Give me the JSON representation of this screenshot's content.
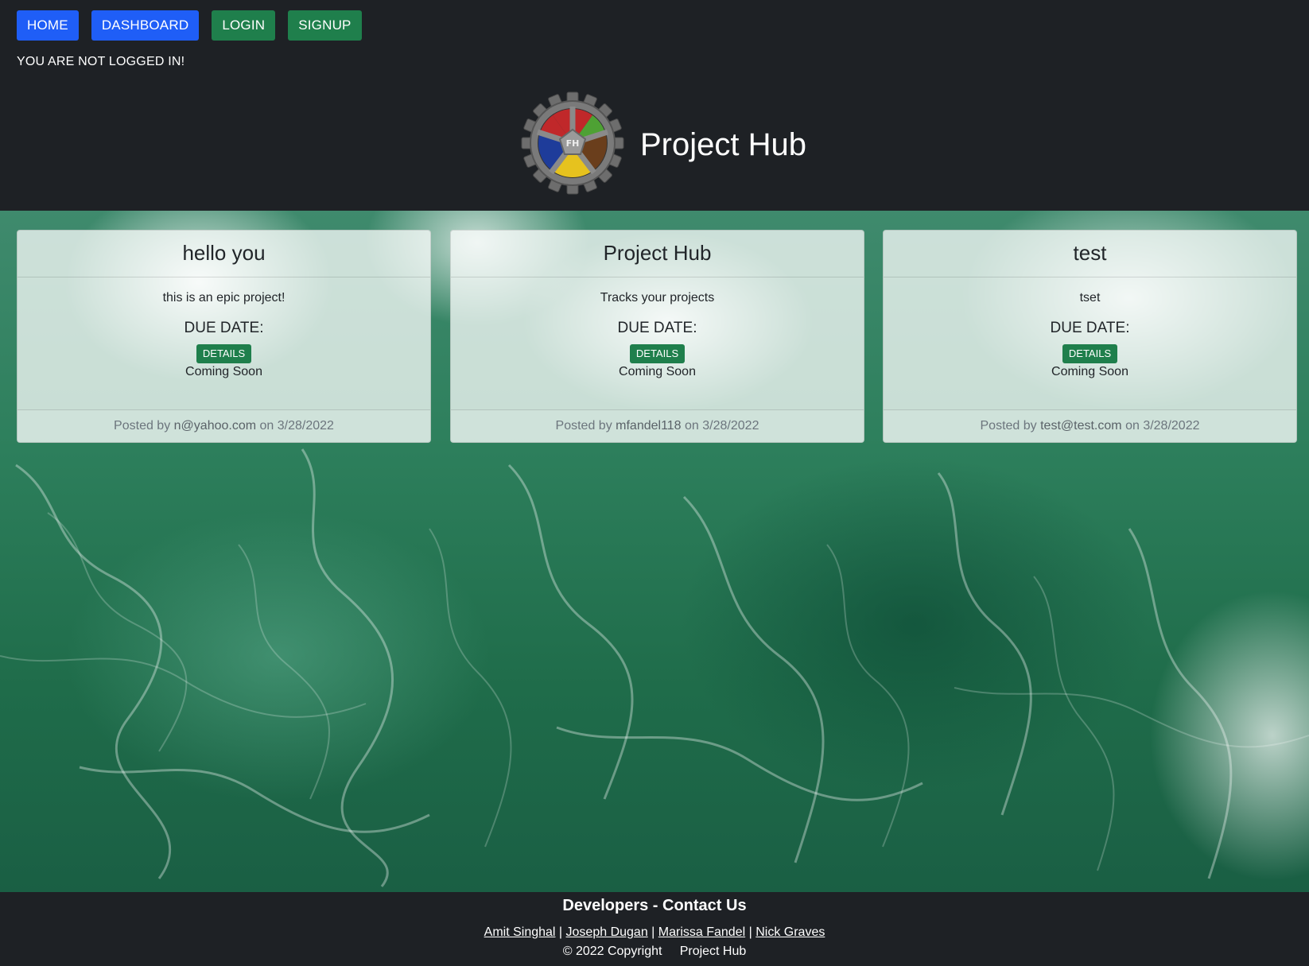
{
  "nav": {
    "home": "HOME",
    "dashboard": "DASHBOARD",
    "login": "LOGIN",
    "signup": "SIGNUP",
    "colors": {
      "home": "#1f5ef7",
      "dashboard": "#1f5ef7",
      "login": "#1f7f4c",
      "signup": "#1f7f4c"
    }
  },
  "status_text": "YOU ARE NOT LOGGED IN!",
  "brand": {
    "title": "Project Hub",
    "logo_icon": "gear-logo-icon",
    "logo_text": "FH"
  },
  "projects": [
    {
      "title": "hello you",
      "description": "this is an epic project!",
      "due_label": "DUE DATE:",
      "details_label": "DETAILS",
      "due_value": "Coming Soon",
      "posted_prefix": "Posted by",
      "user": "n@yahoo.com",
      "on": "on",
      "date": "3/28/2022"
    },
    {
      "title": "Project Hub",
      "description": "Tracks your projects",
      "due_label": "DUE DATE:",
      "details_label": "DETAILS",
      "due_value": "Coming Soon",
      "posted_prefix": "Posted by",
      "user": "mfandel118",
      "on": "on",
      "date": "3/28/2022"
    },
    {
      "title": "test",
      "description": "tset",
      "due_label": "DUE DATE:",
      "details_label": "DETAILS",
      "due_value": "Coming Soon",
      "posted_prefix": "Posted by",
      "user": "test@test.com",
      "on": "on",
      "date": "3/28/2022"
    }
  ],
  "footer": {
    "heading": "Developers - Contact Us",
    "developers": [
      "Amit Singhal",
      "Joseph Dugan",
      "Marissa Fandel",
      "Nick Graves"
    ],
    "separator": "|",
    "copyright": "© 2022 Copyright",
    "site": "Project Hub"
  },
  "accent_colors": {
    "blue": "#1f5ef7",
    "green": "#1f7f4c",
    "dark_bg": "#1e2125"
  }
}
